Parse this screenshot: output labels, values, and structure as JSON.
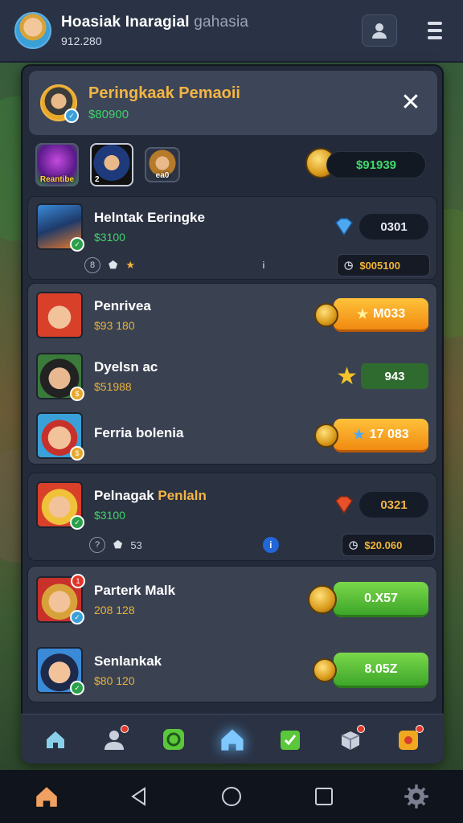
{
  "player": {
    "name": "Hoasiak Inaragial",
    "name_suffix": "gahasia",
    "coins": "912.280"
  },
  "leaderboard": {
    "title": "Peringkaak Pemaoii",
    "subtitle": "$80900",
    "total": "$91939",
    "characters": [
      {
        "label": "Reantibe"
      },
      {
        "label": "2"
      },
      {
        "label": "ea0"
      }
    ]
  },
  "top_entry": {
    "name": "Helntak Eeringke",
    "value": "$3100",
    "score": "0301",
    "info_value": "",
    "payout": "$005100"
  },
  "group_one": [
    {
      "name": "Penrivea",
      "value": "$93 180",
      "action": "M033"
    },
    {
      "name": "Dyelsn ac",
      "value": "$51988",
      "action": "943"
    },
    {
      "name": "Ferria bolenia",
      "value": "",
      "action": "17 083"
    }
  ],
  "second_entry": {
    "name": "Pelnagak",
    "name_accent": "Penlaln",
    "value": "$3100",
    "score": "0321",
    "info_value": "53",
    "payout": "$20.060"
  },
  "group_two": [
    {
      "name": "Parterk Malk",
      "value": "208 128",
      "action": "0.X57"
    },
    {
      "name": "Senlankak",
      "value": "$80 120",
      "action": "8.05Z"
    }
  ],
  "colors": {
    "accent_gold": "#f3b544",
    "accent_green": "#42d36b",
    "panel": "#232a39",
    "orange_button": "#f08a10",
    "green_button": "#3ea62a"
  },
  "icons": {
    "top_bar": [
      "profile-icon",
      "menu-icon"
    ],
    "nav": [
      "home-icon",
      "friends-icon",
      "refresh-icon",
      "home-active-icon",
      "tasks-icon",
      "gift-icon",
      "shop-icon"
    ],
    "system": [
      "home-system-icon",
      "back-icon",
      "circle-home-icon",
      "recent-apps-icon",
      "settings-icon"
    ]
  }
}
